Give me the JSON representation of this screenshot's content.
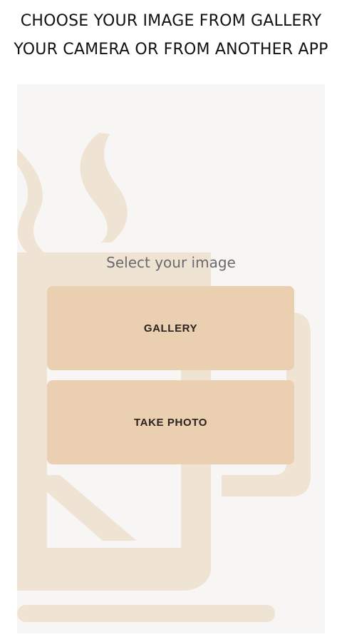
{
  "header": {
    "line1": "CHOOSE YOUR IMAGE FROM GALLERY",
    "line2": "YOUR CAMERA OR FROM ANOTHER APP"
  },
  "screen": {
    "prompt": "Select your image",
    "gallery_label": "GALLERY",
    "take_photo_label": "TAKE PHOTO",
    "background_icon": "coffee-cup-icon"
  },
  "colors": {
    "screen_background": "#f7f6f4",
    "button_fill": "#eacfb0",
    "background_art": "#efe3d4"
  }
}
